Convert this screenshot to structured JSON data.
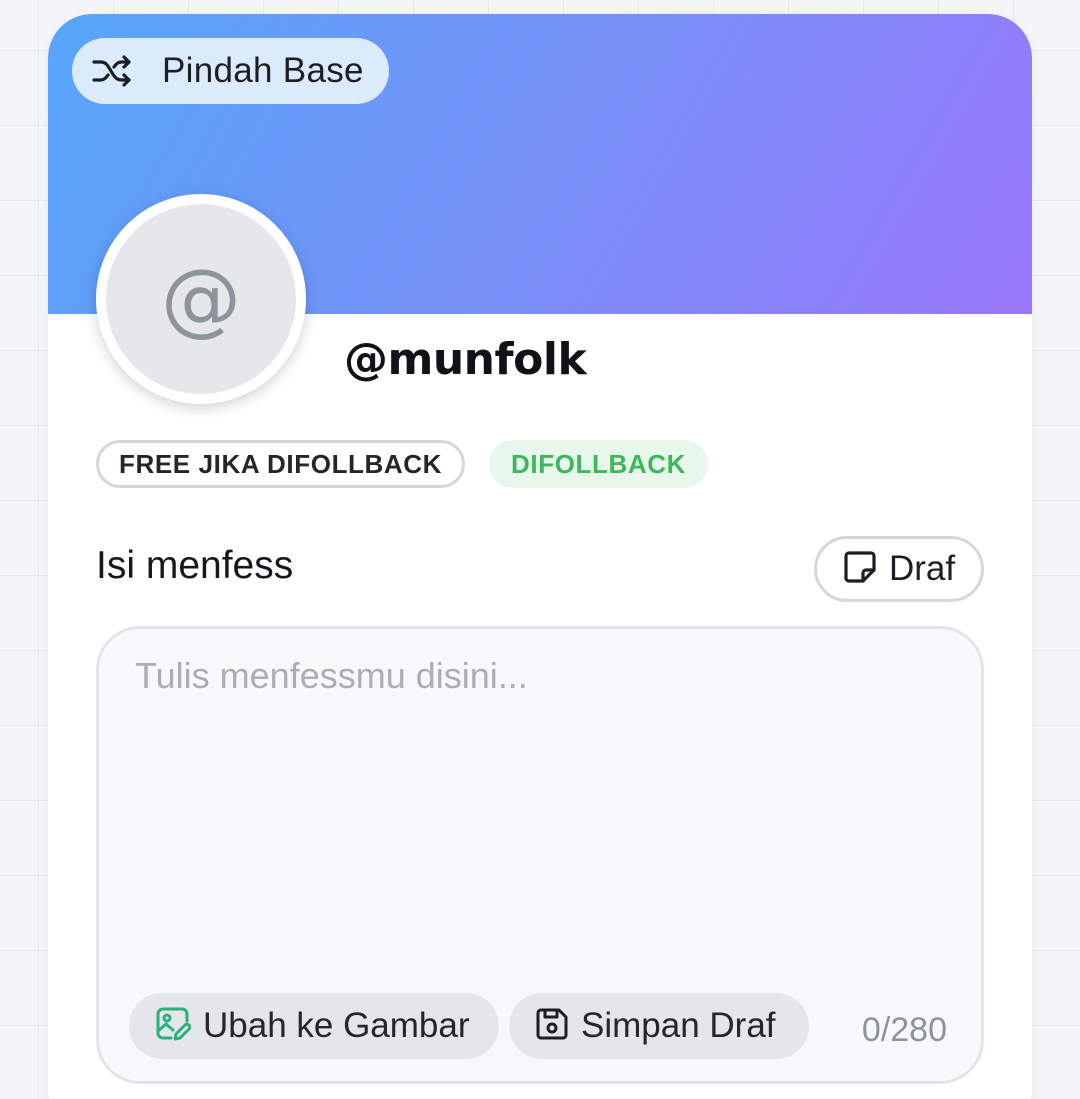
{
  "header": {
    "switch_base_label": "Pindah Base",
    "switch_icon": "shuffle-icon"
  },
  "profile": {
    "avatar_glyph": "@",
    "username": "@munfolk"
  },
  "badges": [
    {
      "label": "FREE JIKA DIFOLLBACK",
      "style": "outline"
    },
    {
      "label": "DIFOLLBACK",
      "style": "green",
      "color": "#3eb75a"
    }
  ],
  "composer": {
    "title": "Isi menfess",
    "draft_button_label": "Draf",
    "draft_icon": "sticky-note-icon",
    "placeholder": "Tulis menfessmu disini...",
    "value": "",
    "to_image_label": "Ubah ke Gambar",
    "to_image_icon": "image-edit-icon",
    "save_draft_label": "Simpan Draf",
    "save_icon": "floppy-disk-icon",
    "counter": "0/280"
  },
  "colors": {
    "banner_start": "#56a6fb",
    "banner_end": "#9877f8",
    "accent_green": "#3eb75a",
    "image_icon": "#2bb07a"
  }
}
